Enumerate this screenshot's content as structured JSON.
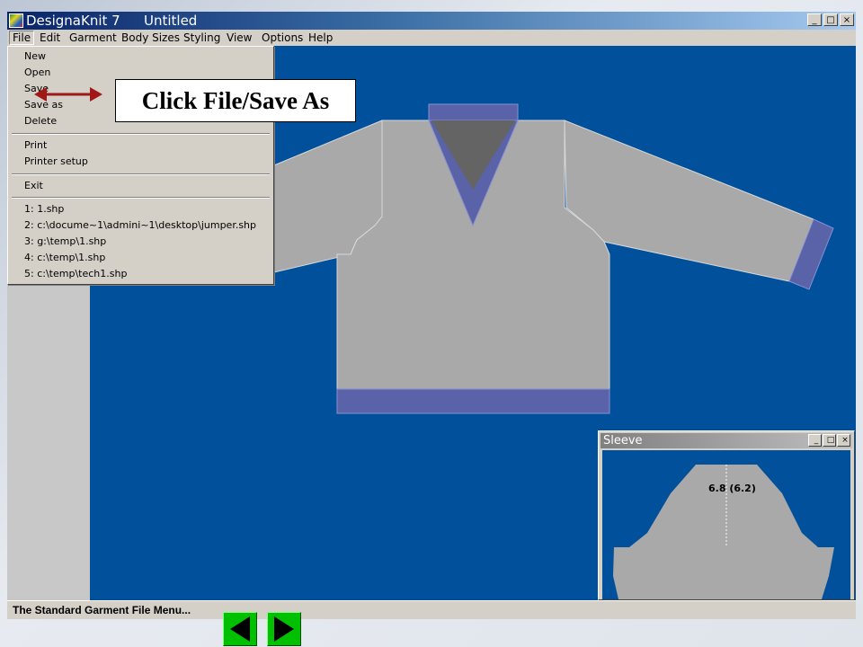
{
  "app": {
    "name": "DesignaKnit 7",
    "document": "Untitled",
    "window_buttons": [
      "_",
      "□",
      "×"
    ]
  },
  "menubar": [
    "File",
    "Edit",
    "Garment",
    "Body Sizes",
    "Styling",
    "View",
    "Options",
    "Help"
  ],
  "file_menu": {
    "items": [
      "New",
      "Open",
      "Save",
      "Save as",
      "Delete"
    ],
    "print_items": [
      "Print",
      "Printer setup"
    ],
    "exit": "Exit",
    "recent": [
      "1:  1.shp",
      "2:  c:\\docume~1\\admini~1\\desktop\\jumper.shp",
      "3:  g:\\temp\\1.shp",
      "4:  c:\\temp\\1.shp",
      "5:  c:\\temp\\tech1.shp"
    ]
  },
  "sleeve_window": {
    "title": "Sleeve",
    "measurement": "6.8  (6.2)"
  },
  "status": "The Standard Garment File Menu...",
  "callout": "Click File/Save As",
  "colors": {
    "workspace_blue": "#00509B",
    "garment_gray": "#A9A9A9",
    "rib_band": "#5A62A8",
    "arrow_red": "#A01818",
    "nav_green": "#00C000"
  },
  "nav": {
    "prev_icon": "triangle-left-icon",
    "next_icon": "triangle-right-icon"
  }
}
